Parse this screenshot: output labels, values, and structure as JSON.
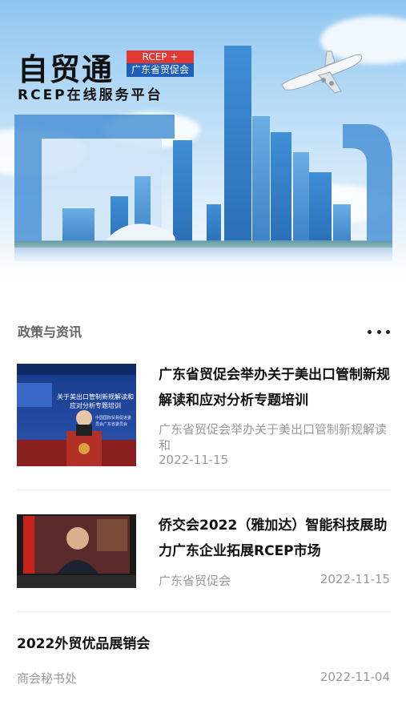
{
  "banner": {
    "title": "自贸通",
    "subtitle": "RCEP在线服务平台",
    "tag_top": "RCEP +",
    "tag_bottom": "广东省贸促会",
    "accent_red": "#e23a32",
    "accent_blue": "#1f5fb8"
  },
  "section": {
    "title": "政策与资讯",
    "more_icon": "more-dots-icon"
  },
  "news": [
    {
      "title": "广东省贸促会举办关于美出口管制新规解读和应对分析专题培训",
      "description": "广东省贸促会举办关于美出口管制新规解读和",
      "date": "2022-11-15",
      "thumb_screen_text": "关于美出口管制新规解读和应对分析专题培训",
      "thumb_side_text": "中国国际贸易促进委员会广东省委员会"
    },
    {
      "title": "侨交会2022（雅加达）智能科技展助力广东企业拓展RCEP市场",
      "source": "广东省贸促会",
      "date": "2022-11-15"
    },
    {
      "title": "2022外贸优品展销会",
      "source": "商会秘书处",
      "date": "2022-11-04"
    }
  ]
}
